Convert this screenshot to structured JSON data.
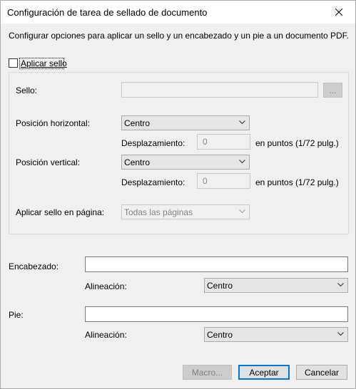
{
  "window": {
    "title": "Configuración de tarea de sellado de documento",
    "description": "Configurar opciones para aplicar un sello y un encabezado y un pie a un documento PDF."
  },
  "stamp": {
    "apply_label": "Aplicar sello",
    "apply_checked": false,
    "stamp_label": "Sello:",
    "stamp_value": "",
    "browse_label": "...",
    "horizontal_label": "Posición horizontal:",
    "horizontal_value": "Centro",
    "h_offset_label": "Desplazamiento:",
    "h_offset_value": "0",
    "h_units": "en puntos (1/72 pulg.)",
    "vertical_label": "Posición vertical:",
    "vertical_value": "Centro",
    "v_offset_label": "Desplazamiento:",
    "v_offset_value": "0",
    "v_units": "en puntos (1/72 pulg.)",
    "pages_label": "Aplicar sello en página:",
    "pages_value": "Todas las páginas"
  },
  "header": {
    "label": "Encabezado:",
    "value": "",
    "align_label": "Alineación:",
    "align_value": "Centro"
  },
  "footer": {
    "label": "Pie:",
    "value": "",
    "align_label": "Alineación:",
    "align_value": "Centro"
  },
  "buttons": {
    "macro": "Macro...",
    "ok": "Aceptar",
    "cancel": "Cancelar"
  },
  "icons": {
    "close": "close-icon",
    "dropdown": "chevron-down-icon"
  },
  "colors": {
    "accent": "#0078d7",
    "window_bg": "#f0f0f0"
  }
}
